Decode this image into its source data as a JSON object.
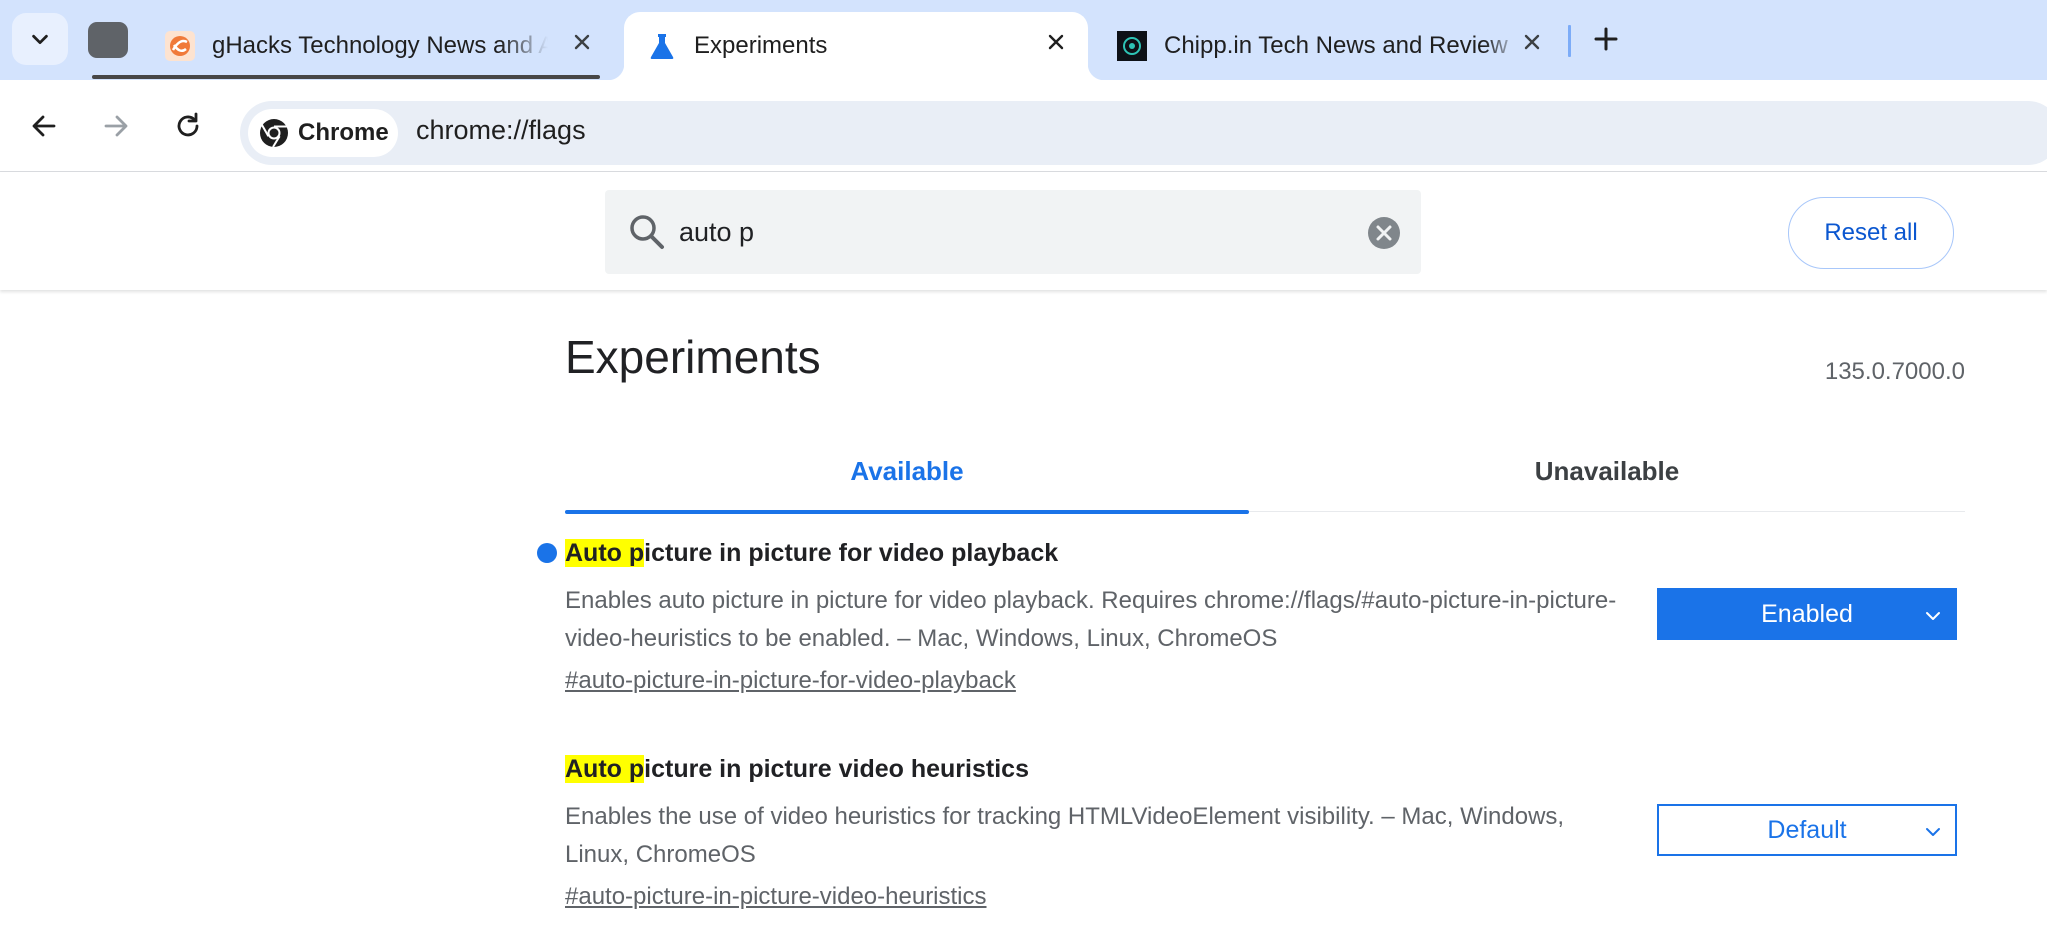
{
  "colors": {
    "tabstrip_bg": "#d3e3fd",
    "accent": "#1a73e8",
    "highlight": "#ffff00"
  },
  "tabs": [
    {
      "title": "gHacks Technology News and A",
      "icon": "ghacks-favicon",
      "active": false
    },
    {
      "title": "Experiments",
      "icon": "flask-icon",
      "active": true
    },
    {
      "title": "Chipp.in Tech News and Review",
      "icon": "chippin-favicon",
      "active": false
    }
  ],
  "omnibox": {
    "chip_label": "Chrome",
    "url": "chrome://flags"
  },
  "search": {
    "value": "auto p"
  },
  "reset_label": "Reset all",
  "page": {
    "title": "Experiments",
    "version": "135.0.7000.0"
  },
  "flag_tabs": {
    "available": "Available",
    "unavailable": "Unavailable"
  },
  "flags": [
    {
      "name_highlight": "Auto p",
      "name_rest": "icture in picture for video playback",
      "description": "Enables auto picture in picture for video playback. Requires chrome://flags/#auto-picture-in-picture-video-heuristics to be enabled. – Mac, Windows, Linux, ChromeOS",
      "link": "#auto-picture-in-picture-for-video-playback",
      "value": "Enabled",
      "modified": true
    },
    {
      "name_highlight": "Auto p",
      "name_rest": "icture in picture video heuristics",
      "description": "Enables the use of video heuristics for tracking HTMLVideoElement visibility. – Mac, Windows, Linux, ChromeOS",
      "link": "#auto-picture-in-picture-video-heuristics",
      "value": "Default",
      "modified": false
    }
  ]
}
